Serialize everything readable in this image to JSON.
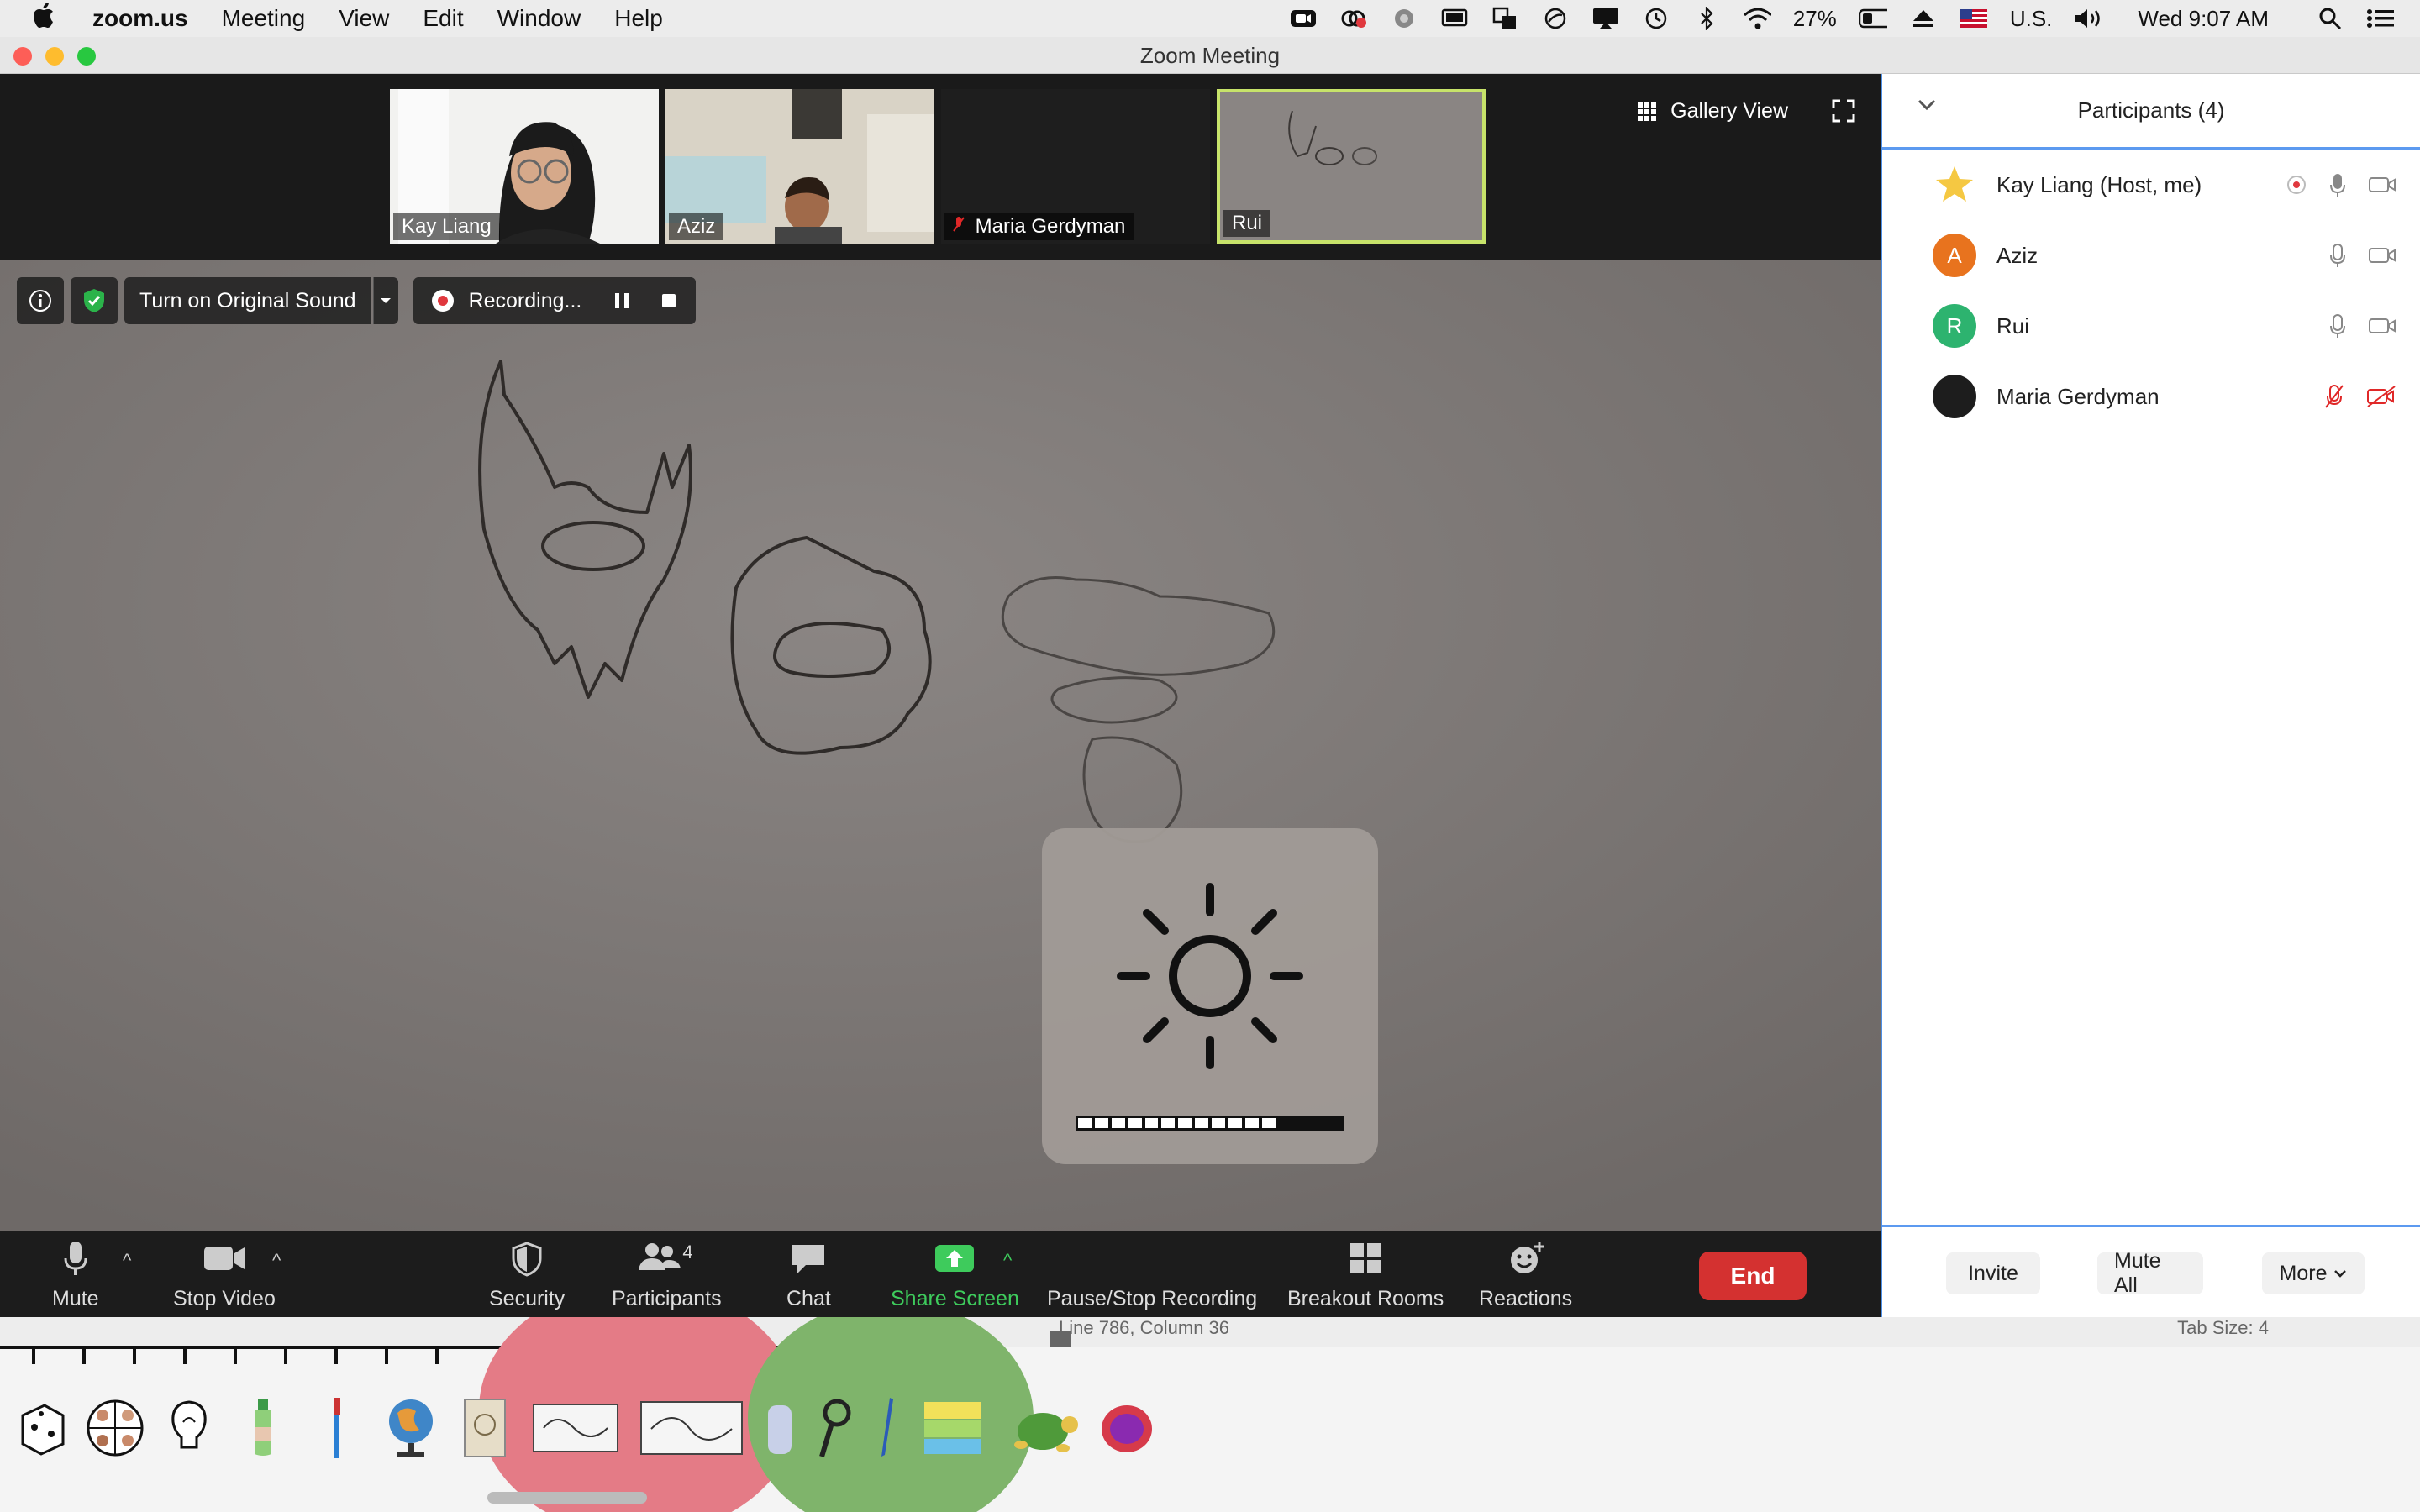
{
  "menubar": {
    "app_name": "zoom.us",
    "items": [
      "Meeting",
      "View",
      "Edit",
      "Window",
      "Help"
    ],
    "battery": "27%",
    "input_source": "U.S.",
    "clock": "Wed 9:07 AM"
  },
  "window": {
    "title": "Zoom Meeting"
  },
  "thumbnails": [
    {
      "name": "Kay Liang",
      "muted": false
    },
    {
      "name": "Aziz",
      "muted": false
    },
    {
      "name": "Maria Gerdyman",
      "muted": true
    },
    {
      "name": "Rui",
      "muted": false,
      "active": true
    }
  ],
  "view": {
    "gallery_label": "Gallery View"
  },
  "overlay": {
    "original_sound": "Turn on Original Sound",
    "recording": "Recording..."
  },
  "brightness": {
    "level_fraction": 0.75
  },
  "toolbar": {
    "mute": "Mute",
    "stop_video": "Stop Video",
    "security": "Security",
    "participants": "Participants",
    "participants_count": "4",
    "chat": "Chat",
    "share_screen": "Share Screen",
    "pause_stop_recording": "Pause/Stop Recording",
    "breakout_rooms": "Breakout Rooms",
    "reactions": "Reactions",
    "end": "End"
  },
  "participants_panel": {
    "title": "Participants (4)",
    "people": [
      {
        "name": "Kay Liang (Host, me)",
        "avatar": "star",
        "avatar_color": "#f5c842",
        "recording": true,
        "mic_muted": false,
        "video_off": false
      },
      {
        "name": "Aziz",
        "avatar": "A",
        "avatar_color": "#e8731e",
        "recording": false,
        "mic_muted": false,
        "video_off": false
      },
      {
        "name": "Rui",
        "avatar": "R",
        "avatar_color": "#2db36f",
        "recording": false,
        "mic_muted": false,
        "video_off": false
      },
      {
        "name": "Maria Gerdyman",
        "avatar": "",
        "avatar_color": "#1d1d1d",
        "recording": false,
        "mic_muted": true,
        "video_off": true
      }
    ],
    "invite": "Invite",
    "mute_all": "Mute All",
    "more": "More"
  },
  "desktop": {
    "editor_status": "Line 786, Column 36",
    "tab_size": "Tab Size: 4"
  },
  "colors": {
    "accent_green": "#3ecb5c",
    "end_red": "#d43130",
    "panel_blue": "#5c9af0",
    "muted_red": "#e02828"
  }
}
